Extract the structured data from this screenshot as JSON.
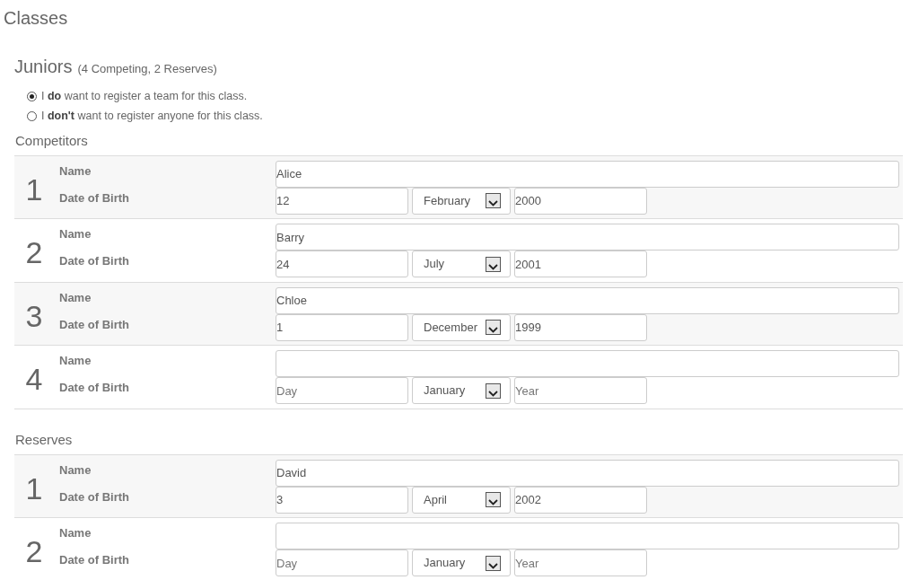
{
  "page_title": "Classes",
  "class": {
    "name": "Juniors",
    "summary": "(4 Competing, 2 Reserves)"
  },
  "options": [
    {
      "text": "I **do** want to register a team for this class.",
      "selected": true
    },
    {
      "text": "I **don't** want to register anyone for this class.",
      "selected": false
    }
  ],
  "sections": [
    {
      "title": "Competitors",
      "entries": [
        {
          "number": "1",
          "name_label": "Name",
          "dob_label": "Date of Birth",
          "name": "Alice",
          "day": "12",
          "month": "February",
          "year": "2000"
        },
        {
          "number": "2",
          "name_label": "Name",
          "dob_label": "Date of Birth",
          "name": "Barry",
          "day": "24",
          "month": "July",
          "year": "2001"
        },
        {
          "number": "3",
          "name_label": "Name",
          "dob_label": "Date of Birth",
          "name": "Chloe",
          "day": "1",
          "month": "December",
          "year": "1999"
        },
        {
          "number": "4",
          "name_label": "Name",
          "dob_label": "Date of Birth",
          "day_placeholder": "Day",
          "month": "January",
          "year_placeholder": "Year"
        }
      ]
    },
    {
      "title": "Reserves",
      "entries": [
        {
          "number": "1",
          "name_label": "Name",
          "dob_label": "Date of Birth",
          "name": "David",
          "day": "3",
          "month": "April",
          "year": "2002"
        },
        {
          "number": "2",
          "name_label": "Name",
          "dob_label": "Date of Birth",
          "day_placeholder": "Day",
          "month": "January",
          "year_placeholder": "Year"
        }
      ]
    }
  ]
}
